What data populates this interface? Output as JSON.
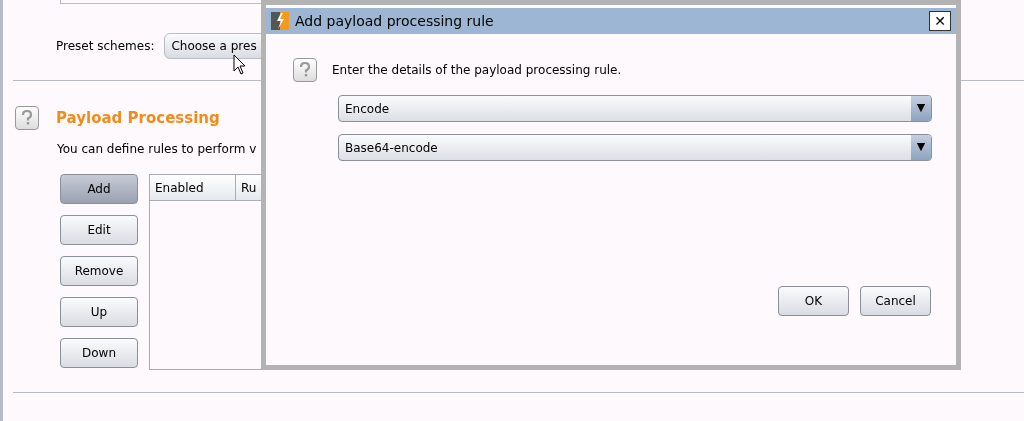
{
  "preset": {
    "label": "Preset schemes:",
    "value": "Choose a pres"
  },
  "section": {
    "title": "Payload Processing",
    "description": "You can define rules to perform v"
  },
  "buttons": [
    {
      "label": "Add",
      "selected": true
    },
    {
      "label": "Edit",
      "selected": false
    },
    {
      "label": "Remove",
      "selected": false
    },
    {
      "label": "Up",
      "selected": false
    },
    {
      "label": "Down",
      "selected": false
    }
  ],
  "table": {
    "columns": [
      "Enabled",
      "Ru"
    ]
  },
  "dialog": {
    "title": "Add payload processing rule",
    "message": "Enter the details of the payload processing rule.",
    "close": "✕",
    "selects": [
      {
        "value": "Encode"
      },
      {
        "value": "Base64-encode"
      }
    ],
    "arrow": "▼",
    "buttons": [
      "OK",
      "Cancel"
    ]
  }
}
